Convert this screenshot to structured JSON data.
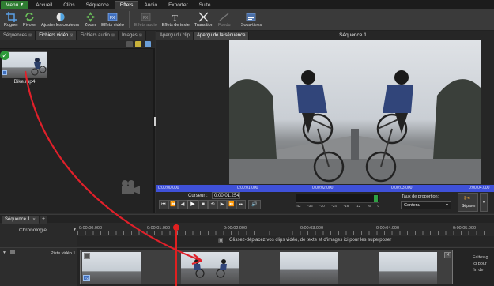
{
  "menubar": {
    "main_label": "Menu",
    "items": [
      "Accueil",
      "Clips",
      "Séquence",
      "Effets",
      "Audio",
      "Exporter",
      "Suite"
    ],
    "active_index": 3
  },
  "ribbon": {
    "buttons": [
      {
        "label": "Rogner",
        "icon": "crop-icon",
        "enabled": true
      },
      {
        "label": "Pivoter",
        "icon": "rotate-icon",
        "enabled": true
      },
      {
        "label": "Ajuster les couleurs",
        "icon": "color-adjust-icon",
        "enabled": true
      },
      {
        "label": "Zoom",
        "icon": "zoom-icon",
        "enabled": true
      },
      {
        "label": "Effets vidéo",
        "icon": "video-fx-icon",
        "enabled": true
      },
      {
        "label": "Effets audio",
        "icon": "audio-fx-icon",
        "enabled": false
      },
      {
        "label": "Effets de texte",
        "icon": "text-fx-icon",
        "enabled": true
      },
      {
        "label": "Transition",
        "icon": "transition-icon",
        "enabled": true
      },
      {
        "label": "Fondu",
        "icon": "fade-icon",
        "enabled": false
      },
      {
        "label": "Sous-titres",
        "icon": "subtitles-icon",
        "enabled": true
      }
    ]
  },
  "left_panel": {
    "tabs": [
      "Séquences",
      "Fichiers vidéo",
      "Fichiers audio",
      "Images"
    ],
    "active_tab": 1,
    "media_item": {
      "name": "Bike.mp4"
    }
  },
  "preview": {
    "tabs": [
      "Aperçu du clip",
      "Aperçu de la séquence"
    ],
    "active_tab": 1,
    "title": "Séquence 1",
    "ruler_ticks": [
      "0:00:00.000",
      "0:00:01.000",
      "0:00:02.000",
      "0:00:03.000",
      "0:00:04.000"
    ],
    "cursor_label": "Curseur :",
    "cursor_value": "0:00:01.254",
    "db_scale": [
      "-42",
      "-36",
      "-30",
      "-24",
      "-18",
      "-12",
      "-6",
      "0"
    ],
    "aspect_label": "Taux de proportion:",
    "aspect_value": "Contenu",
    "split_label": "Séparer"
  },
  "timeline": {
    "tab": "Séquence 1",
    "add_tab": "+",
    "chronology_label": "Chronologie",
    "ruler_ticks": [
      "0:00:00.000",
      "0:00:01.000",
      "0:00:02.000",
      "0:00:03.000",
      "0:00:04.000",
      "0:00:05.000"
    ],
    "overlay_hint": "Glissez-déplacez vos clips vidéo, de texte et d'images ici pour les superposer",
    "track_label": "Piste vidéo 1",
    "right_hint_lines": [
      "Faites g",
      "ici pour",
      "fin de"
    ]
  },
  "colors": {
    "accent_green": "#2f7d32",
    "playhead": "#e02020",
    "progress_bar": "#3f51d9",
    "arrow": "#e0202a"
  }
}
